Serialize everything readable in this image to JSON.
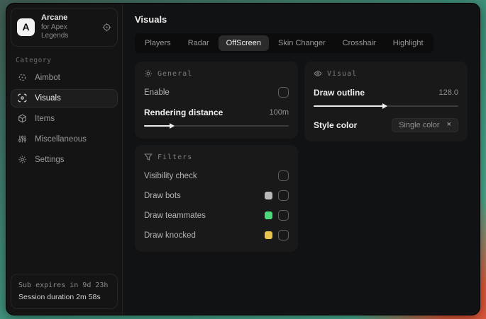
{
  "app": {
    "logo_letter": "A",
    "name": "Arcane",
    "subtitle": "for Apex Legends"
  },
  "sidebar": {
    "category_label": "Category",
    "items": [
      {
        "label": "Aimbot",
        "icon": "crosshair-icon",
        "selected": false
      },
      {
        "label": "Visuals",
        "icon": "eye-scan-icon",
        "selected": true
      },
      {
        "label": "Items",
        "icon": "box-icon",
        "selected": false
      },
      {
        "label": "Miscellaneous",
        "icon": "sliders-icon",
        "selected": false
      },
      {
        "label": "Settings",
        "icon": "gear-icon",
        "selected": false
      }
    ],
    "footer": {
      "sub_expires": "Sub expires in 9d 23h",
      "session_duration": "Session duration 2m 58s"
    }
  },
  "main": {
    "title": "Visuals",
    "tabs": [
      {
        "label": "Players",
        "selected": false
      },
      {
        "label": "Radar",
        "selected": false
      },
      {
        "label": "OffScreen",
        "selected": true
      },
      {
        "label": "Skin Changer",
        "selected": false
      },
      {
        "label": "Crosshair",
        "selected": false
      },
      {
        "label": "Highlight",
        "selected": false
      }
    ],
    "panels": {
      "general": {
        "title": "General",
        "enable_label": "Enable",
        "rendering_distance_label": "Rendering distance",
        "rendering_distance_value": "100m",
        "rendering_distance_fill": "20%"
      },
      "visual": {
        "title": "Visual",
        "draw_outline_label": "Draw outline",
        "draw_outline_value": "128.0",
        "draw_outline_fill": "50%",
        "style_color_label": "Style color",
        "style_color_value": "Single color",
        "style_color_clear": "×"
      },
      "filters": {
        "title": "Filters",
        "rows": [
          {
            "label": "Visibility check",
            "swatch": null
          },
          {
            "label": "Draw bots",
            "swatch": "#b9b9b9"
          },
          {
            "label": "Draw teammates",
            "swatch": "#4cd97b"
          },
          {
            "label": "Draw knocked",
            "swatch": "#e6c44d"
          }
        ]
      }
    }
  },
  "colors": {
    "bot_swatch": "#b9b9b9",
    "teammate_swatch": "#4cd97b",
    "knocked_swatch": "#e6c44d",
    "bg_teal": "#4fbd9d",
    "bg_orange": "#e0583a"
  }
}
